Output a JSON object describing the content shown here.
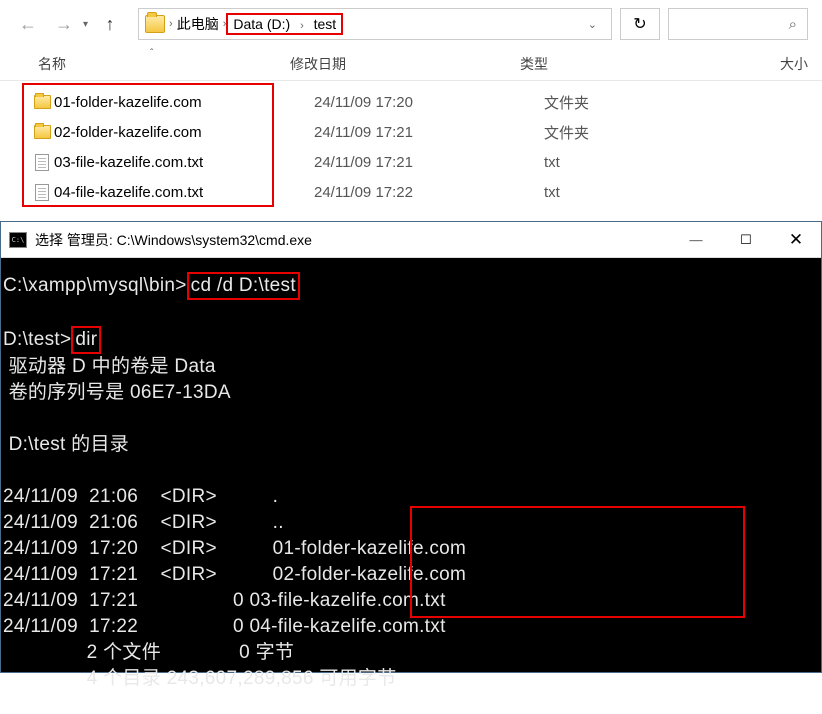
{
  "nav": {
    "back": "←",
    "forward": "→",
    "up": "↑"
  },
  "breadcrumb": {
    "root": "此电脑",
    "drive": "Data (D:)",
    "folder": "test"
  },
  "refresh": "↻",
  "search": "⌕",
  "columns": {
    "name": "名称",
    "date": "修改日期",
    "type": "类型",
    "size": "大小"
  },
  "files": [
    {
      "icon": "folder",
      "name": "01-folder-kazelife.com",
      "date": "24/11/09 17:20",
      "type": "文件夹"
    },
    {
      "icon": "folder",
      "name": "02-folder-kazelife.com",
      "date": "24/11/09 17:21",
      "type": "文件夹"
    },
    {
      "icon": "file",
      "name": "03-file-kazelife.com.txt",
      "date": "24/11/09 17:21",
      "type": "txt"
    },
    {
      "icon": "file",
      "name": "04-file-kazelife.com.txt",
      "date": "24/11/09 17:22",
      "type": "txt"
    }
  ],
  "cmd": {
    "title": "选择 管理员: C:\\Windows\\system32\\cmd.exe",
    "min": "—",
    "max": "☐",
    "close": "✕",
    "prompt1": "C:\\xampp\\mysql\\bin>",
    "cmd1": "cd /d D:\\test",
    "prompt2": "D:\\test>",
    "cmd2": "dir",
    "vol": " 驱动器 D 中的卷是 Data",
    "serial": " 卷的序列号是 06E7-13DA",
    "dirof": " D:\\test 的目录",
    "rows": [
      "24/11/09  21:06    <DIR>          .",
      "24/11/09  21:06    <DIR>          ..",
      "24/11/09  17:20    <DIR>          01-folder-kazelife.com",
      "24/11/09  17:21    <DIR>          02-folder-kazelife.com",
      "24/11/09  17:21                 0 03-file-kazelife.com.txt",
      "24/11/09  17:22                 0 04-file-kazelife.com.txt"
    ],
    "sum1": "               2 个文件              0 字节",
    "sum2": "               4 个目录 243,607,289,856 可用字节"
  }
}
